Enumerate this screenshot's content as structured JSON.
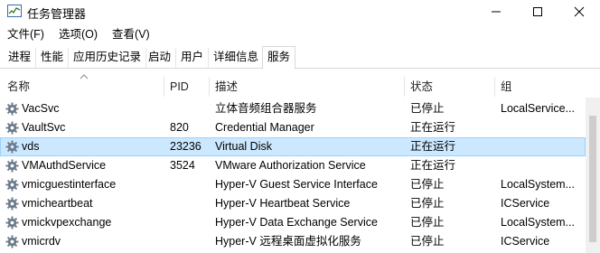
{
  "window": {
    "title": "任务管理器",
    "icon": "task-manager-icon"
  },
  "menu": [
    "文件(F)",
    "选项(O)",
    "查看(V)"
  ],
  "tabs": [
    {
      "label": "进程",
      "active": false
    },
    {
      "label": "性能",
      "active": false
    },
    {
      "label": "应用历史记录",
      "active": false
    },
    {
      "label": "启动",
      "active": false
    },
    {
      "label": "用户",
      "active": false
    },
    {
      "label": "详细信息",
      "active": false
    },
    {
      "label": "服务",
      "active": true
    }
  ],
  "columns": {
    "name": "名称",
    "pid": "PID",
    "description": "描述",
    "status": "状态",
    "group": "组"
  },
  "services": [
    {
      "name": "VacSvc",
      "pid": "",
      "description": "立体音频组合器服务",
      "status": "已停止",
      "group": "LocalService..."
    },
    {
      "name": "VaultSvc",
      "pid": "820",
      "description": "Credential Manager",
      "status": "正在运行",
      "group": ""
    },
    {
      "name": "vds",
      "pid": "23236",
      "description": "Virtual Disk",
      "status": "正在运行",
      "group": "",
      "selected": true
    },
    {
      "name": "VMAuthdService",
      "pid": "3524",
      "description": "VMware Authorization Service",
      "status": "正在运行",
      "group": ""
    },
    {
      "name": "vmicguestinterface",
      "pid": "",
      "description": "Hyper-V Guest Service Interface",
      "status": "已停止",
      "group": "LocalSystem..."
    },
    {
      "name": "vmicheartbeat",
      "pid": "",
      "description": "Hyper-V Heartbeat Service",
      "status": "已停止",
      "group": "ICService"
    },
    {
      "name": "vmickvpexchange",
      "pid": "",
      "description": "Hyper-V Data Exchange Service",
      "status": "已停止",
      "group": "LocalSystem..."
    },
    {
      "name": "vmicrdv",
      "pid": "",
      "description": "Hyper-V 远程桌面虚拟化服务",
      "status": "已停止",
      "group": "ICService"
    }
  ],
  "colors": {
    "selection": "#cce8ff",
    "selection_border": "#99d1ff",
    "gear": "#6b7a8a"
  }
}
